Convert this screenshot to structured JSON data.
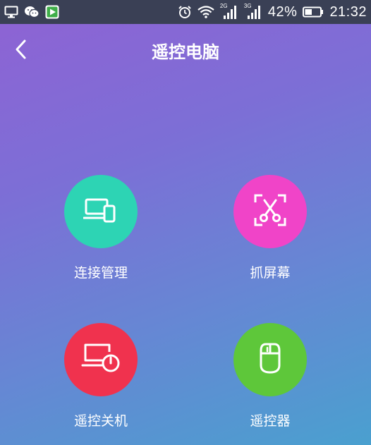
{
  "status_bar": {
    "battery": "42%",
    "time": "21:32",
    "signal1_tag": "2G",
    "signal2_tag": "3G",
    "icons_left": [
      "monitor-icon",
      "wechat-icon",
      "play-app-icon"
    ],
    "icons_right": [
      "alarm-icon",
      "wifi-icon",
      "signal-icon",
      "signal-icon",
      "battery-icon"
    ]
  },
  "header": {
    "title": "遥控电脑",
    "back_icon": "chevron-left-icon"
  },
  "actions": [
    {
      "label": "连接管理",
      "icon": "devices-icon",
      "color": "#2dd4b4"
    },
    {
      "label": "抓屏幕",
      "icon": "scissors-capture-icon",
      "color": "#f044c8"
    },
    {
      "label": "遥控关机",
      "icon": "monitor-power-icon",
      "color": "#f0324e"
    },
    {
      "label": "遥控器",
      "icon": "mouse-icon",
      "color": "#5ec73a"
    }
  ],
  "colors": {
    "status_bar_bg": "#3a4055",
    "gradient_start": "#8f62d4",
    "gradient_end": "#4aa0cf"
  }
}
